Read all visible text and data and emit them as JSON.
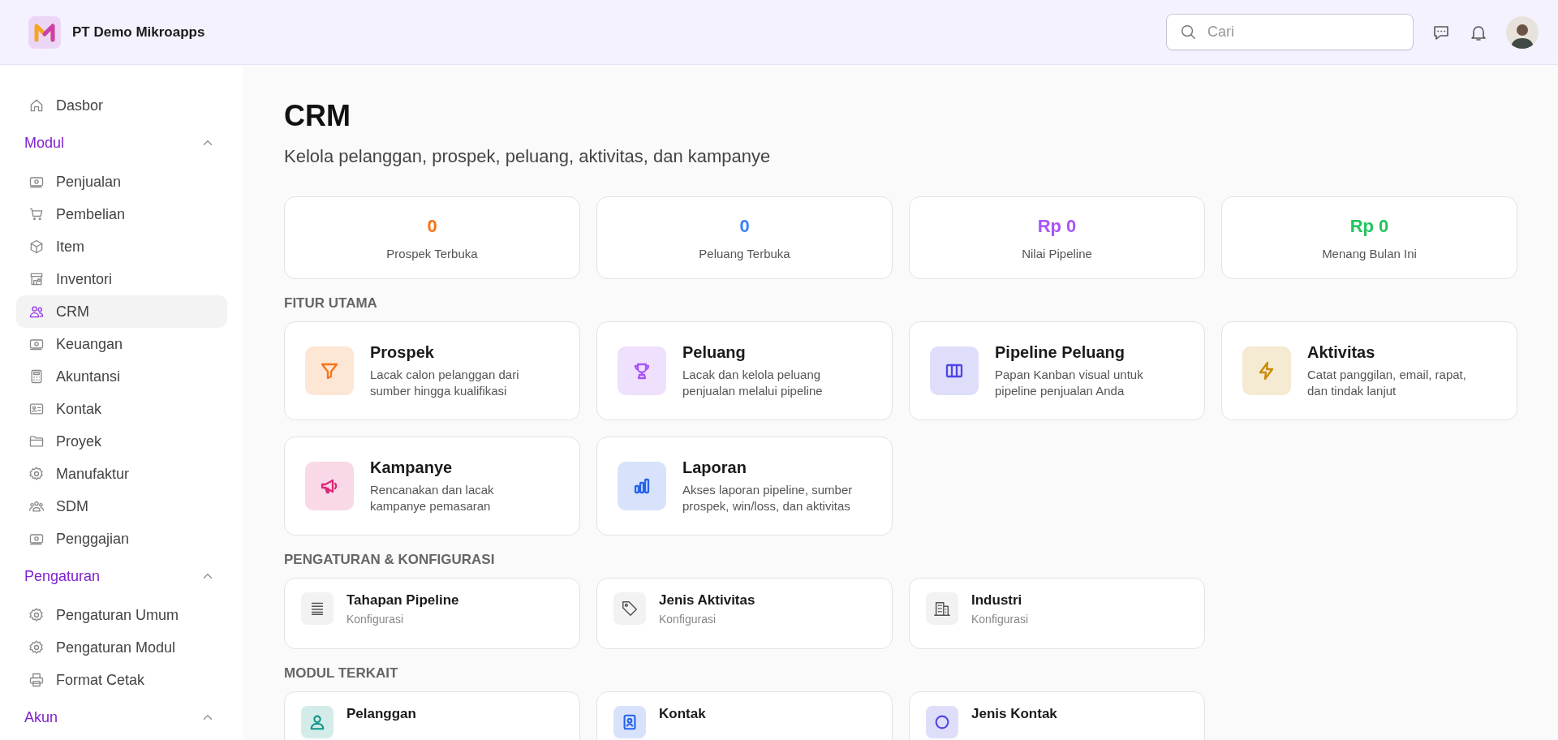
{
  "header": {
    "company": "PT Demo Mikroapps",
    "search": {
      "placeholder": "Cari"
    }
  },
  "sidebar": {
    "items": [
      {
        "label": "Dasbor",
        "selected": false
      }
    ],
    "groups": [
      {
        "title": "Modul",
        "expanded": true,
        "items": [
          {
            "label": "Penjualan",
            "selected": false
          },
          {
            "label": "Pembelian",
            "selected": false
          },
          {
            "label": "Item",
            "selected": false
          },
          {
            "label": "Inventori",
            "selected": false
          },
          {
            "label": "CRM",
            "selected": true
          },
          {
            "label": "Keuangan",
            "selected": false
          },
          {
            "label": "Akuntansi",
            "selected": false
          },
          {
            "label": "Kontak",
            "selected": false
          },
          {
            "label": "Proyek",
            "selected": false
          },
          {
            "label": "Manufaktur",
            "selected": false
          },
          {
            "label": "SDM",
            "selected": false
          },
          {
            "label": "Penggajian",
            "selected": false
          }
        ]
      },
      {
        "title": "Pengaturan",
        "expanded": true,
        "items": [
          {
            "label": "Pengaturan Umum",
            "selected": false
          },
          {
            "label": "Pengaturan Modul",
            "selected": false
          },
          {
            "label": "Format Cetak",
            "selected": false
          }
        ]
      },
      {
        "title": "Akun",
        "expanded": true
      }
    ]
  },
  "page": {
    "title": "CRM",
    "subtitle": "Kelola pelanggan, prospek, peluang, aktivitas, dan kampanye"
  },
  "stats": [
    {
      "value": "0",
      "label": "Prospek Terbuka",
      "color": "#f97316"
    },
    {
      "value": "0",
      "label": "Peluang Terbuka",
      "color": "#3b82f6"
    },
    {
      "value": "Rp 0",
      "label": "Nilai Pipeline",
      "color": "#a855f7"
    },
    {
      "value": "Rp 0",
      "label": "Menang Bulan Ini",
      "color": "#22c55e"
    }
  ],
  "sections": [
    {
      "title": "FITUR UTAMA",
      "kind": "feature",
      "cards": [
        {
          "title": "Prospek",
          "description": "Lacak calon pelanggan dari sumber hingga kualifikasi",
          "color": "#f97316"
        },
        {
          "title": "Peluang",
          "description": "Lacak dan kelola peluang penjualan melalui pipeline",
          "color": "#a855f7"
        },
        {
          "title": "Pipeline Peluang",
          "description": "Papan Kanban visual untuk pipeline penjualan Anda",
          "color": "#4f46e5"
        },
        {
          "title": "Aktivitas",
          "description": "Catat panggilan, email, rapat, dan tindak lanjut",
          "color": "#ca8a04"
        },
        {
          "title": "Kampanye",
          "description": "Rencanakan dan lacak kampanye pemasaran",
          "color": "#db2777"
        },
        {
          "title": "Laporan",
          "description": "Akses laporan pipeline, sumber prospek, win/loss, dan aktivitas",
          "color": "#2563eb"
        }
      ]
    },
    {
      "title": "PENGATURAN & KONFIGURASI",
      "kind": "config",
      "cards": [
        {
          "title": "Tahapan Pipeline",
          "description": "Konfigurasi"
        },
        {
          "title": "Jenis Aktivitas",
          "description": "Konfigurasi"
        },
        {
          "title": "Industri",
          "description": "Konfigurasi"
        }
      ]
    },
    {
      "title": "MODUL TERKAIT",
      "kind": "config",
      "cards": [
        {
          "title": "Pelanggan",
          "color": "#0d9488"
        },
        {
          "title": "Kontak",
          "color": "#2563eb"
        },
        {
          "title": "Jenis Kontak",
          "color": "#4f46e5"
        }
      ]
    }
  ]
}
